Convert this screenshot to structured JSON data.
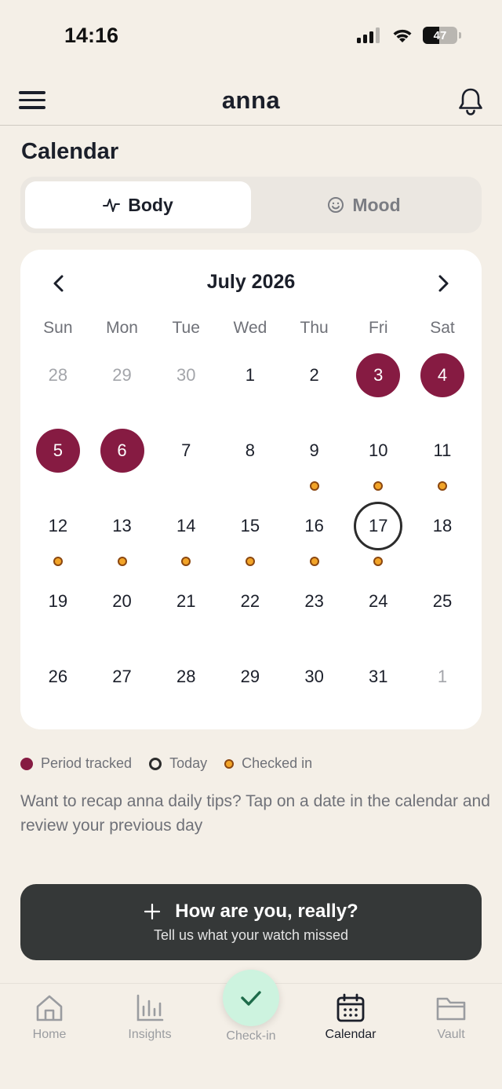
{
  "status": {
    "time": "14:16",
    "battery": "47"
  },
  "header": {
    "logo": "anna"
  },
  "page": {
    "title": "Calendar"
  },
  "tabs": [
    {
      "label": "Body",
      "icon": "pulse-icon",
      "active": true
    },
    {
      "label": "Mood",
      "icon": "smiley-icon",
      "active": false
    }
  ],
  "calendar": {
    "month": "July 2026",
    "weekdays": [
      "Sun",
      "Mon",
      "Tue",
      "Wed",
      "Thu",
      "Fri",
      "Sat"
    ],
    "weeks": [
      [
        {
          "d": "28",
          "muted": true
        },
        {
          "d": "29",
          "muted": true
        },
        {
          "d": "30",
          "muted": true
        },
        {
          "d": "1"
        },
        {
          "d": "2"
        },
        {
          "d": "3",
          "period": true
        },
        {
          "d": "4",
          "period": true
        }
      ],
      [
        {
          "d": "5",
          "period": true
        },
        {
          "d": "6",
          "period": true
        },
        {
          "d": "7"
        },
        {
          "d": "8"
        },
        {
          "d": "9",
          "checkin": true
        },
        {
          "d": "10",
          "checkin": true
        },
        {
          "d": "11",
          "checkin": true
        }
      ],
      [
        {
          "d": "12",
          "checkin": true
        },
        {
          "d": "13",
          "checkin": true
        },
        {
          "d": "14",
          "checkin": true
        },
        {
          "d": "15",
          "checkin": true
        },
        {
          "d": "16",
          "checkin": true
        },
        {
          "d": "17",
          "today": true,
          "checkin": true
        },
        {
          "d": "18"
        }
      ],
      [
        {
          "d": "19"
        },
        {
          "d": "20"
        },
        {
          "d": "21"
        },
        {
          "d": "22"
        },
        {
          "d": "23"
        },
        {
          "d": "24"
        },
        {
          "d": "25"
        }
      ],
      [
        {
          "d": "26"
        },
        {
          "d": "27"
        },
        {
          "d": "28"
        },
        {
          "d": "29"
        },
        {
          "d": "30"
        },
        {
          "d": "31"
        },
        {
          "d": "1",
          "muted": true
        }
      ]
    ]
  },
  "legend": {
    "period": "Period tracked",
    "today": "Today",
    "checked": "Checked in"
  },
  "hint": "Want to recap anna daily tips? Tap on a date in the calendar and review your previous day",
  "cta": {
    "title": "How are you, really?",
    "subtitle": "Tell us what your watch missed"
  },
  "nav": {
    "home": "Home",
    "insights": "Insights",
    "checkin": "Check-in",
    "calendar": "Calendar",
    "vault": "Vault"
  },
  "colors": {
    "period": "#861b42",
    "checkin": "#f2a428",
    "background": "#f4efe7",
    "cta": "#353838",
    "fab": "#cdf3df"
  }
}
